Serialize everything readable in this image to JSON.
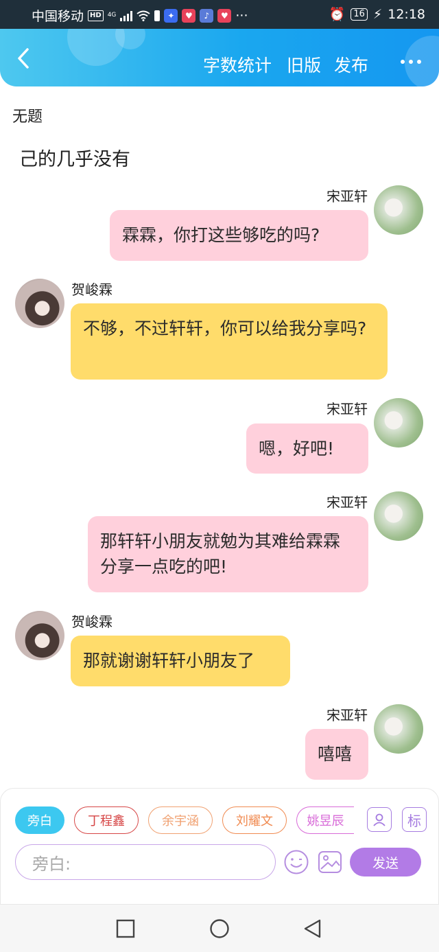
{
  "status_bar": {
    "carrier": "中国移动",
    "hd": "HD",
    "network": "4G",
    "battery": "16",
    "time": "12:18"
  },
  "header": {
    "word_count": "字数统计",
    "old_version": "旧版",
    "publish": "发布"
  },
  "document": {
    "title": "无题",
    "line": "己的几乎没有"
  },
  "messages": [
    {
      "sender": "宋亚轩",
      "side": "right",
      "text": "霖霖，你打这些够吃的吗?"
    },
    {
      "sender": "贺峻霖",
      "side": "left",
      "text": "不够，不过轩轩，你可以给我分享吗?"
    },
    {
      "sender": "宋亚轩",
      "side": "right",
      "text": "嗯，好吧!"
    },
    {
      "sender": "宋亚轩",
      "side": "right",
      "text": "那轩轩小朋友就勉为其难给霖霖分享一点吃的吧!"
    },
    {
      "sender": "贺峻霖",
      "side": "left",
      "text": "那就谢谢轩轩小朋友了"
    },
    {
      "sender": "宋亚轩",
      "side": "right",
      "text": "嘻嘻"
    }
  ],
  "roles": [
    {
      "label": "旁白",
      "color": "#3cc8f0"
    },
    {
      "label": "丁程鑫",
      "color": "#d64545"
    },
    {
      "label": "余宇涵",
      "color": "#f0a070"
    },
    {
      "label": "刘耀文",
      "color": "#f08a50"
    },
    {
      "label": "姚昱辰",
      "color": "#d86ad8"
    }
  ],
  "role_tag_icon": "标",
  "input": {
    "placeholder": "旁白:"
  },
  "send_label": "发送"
}
